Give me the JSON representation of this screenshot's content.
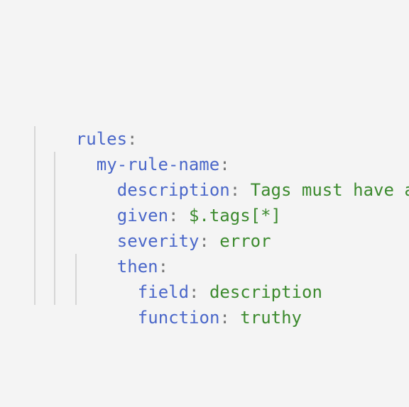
{
  "colors": {
    "background": "#f4f4f4",
    "key": "#4a67c9",
    "value": "#3c8a2e",
    "punctuation": "#777777",
    "indent_guide": "#d6d6d6"
  },
  "code": {
    "colon": ":",
    "lines": [
      {
        "key": "rules",
        "value": ""
      },
      {
        "key": "my-rule-name",
        "value": ""
      },
      {
        "key": "description",
        "value": "Tags must have a description"
      },
      {
        "key": "given",
        "value": "$.tags[*]"
      },
      {
        "key": "severity",
        "value": "error"
      },
      {
        "key": "then",
        "value": ""
      },
      {
        "key": "field",
        "value": "description"
      },
      {
        "key": "function",
        "value": "truthy"
      }
    ]
  }
}
